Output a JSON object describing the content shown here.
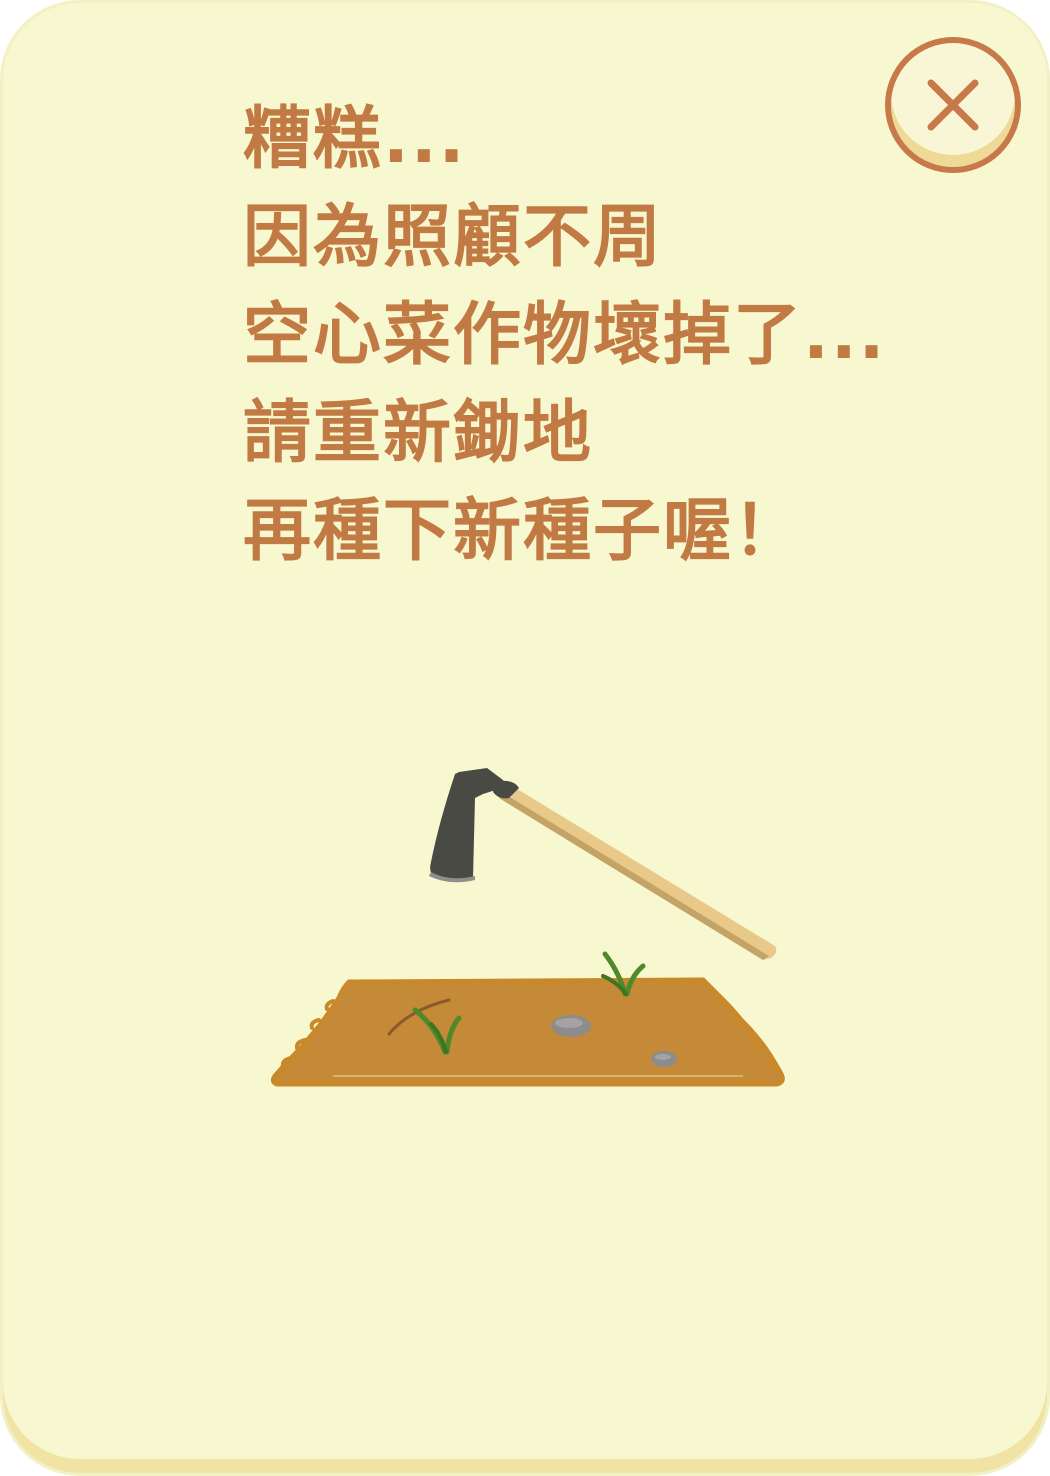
{
  "dialog": {
    "message_lines": [
      "糟糕...",
      "因為照顧不周",
      "空心菜作物壞掉了...",
      "請重新鋤地",
      "再種下新種子喔！"
    ],
    "close_icon": "close-x-icon",
    "illustration": "hoe-over-plowed-field",
    "colors": {
      "card_background": "#f8f8d0",
      "card_shadow": "#f0e3a4",
      "text": "#c27a44",
      "close_ring": "#c7794a",
      "soil": "#c48a38",
      "soil_edge": "#c9882a",
      "hoe_blade": "#4a4a44",
      "hoe_handle": "#e9c98a",
      "sprout": "#4e8a2a",
      "stone": "#8c8c8c"
    }
  }
}
